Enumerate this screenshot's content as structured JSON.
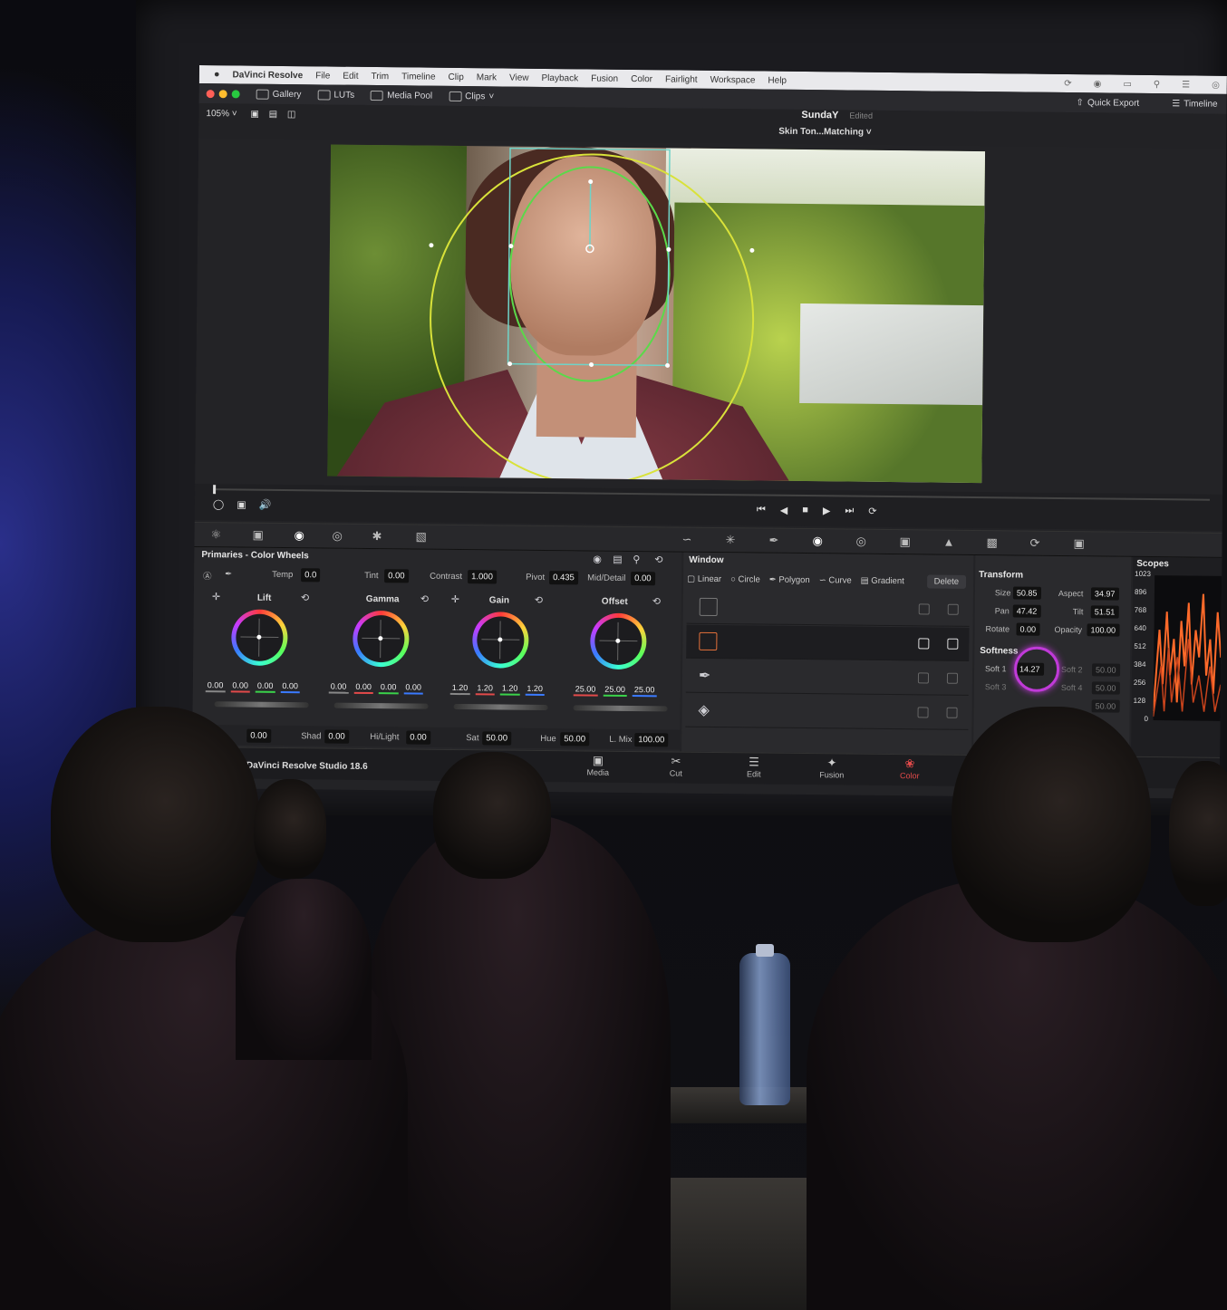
{
  "menubar": {
    "app_name": "DaVinci Resolve",
    "items": [
      "File",
      "Edit",
      "Trim",
      "Timeline",
      "Clip",
      "Mark",
      "View",
      "Playback",
      "Fusion",
      "Color",
      "Fairlight",
      "Workspace",
      "Help"
    ]
  },
  "toolbar": {
    "gallery": "Gallery",
    "luts": "LUTs",
    "media_pool": "Media Pool",
    "clips": "Clips",
    "quick_export": "Quick Export",
    "timeline": "Timeline"
  },
  "viewer_header": {
    "zoom": "105%",
    "project_name": "SundaY",
    "status": "Edited",
    "timeline_name": "Skin Ton...Matching"
  },
  "primaries": {
    "title": "Primaries - Color Wheels",
    "adjust": {
      "temp_label": "Temp",
      "temp": "0.0",
      "tint_label": "Tint",
      "tint": "0.00",
      "contrast_label": "Contrast",
      "contrast": "1.000",
      "pivot_label": "Pivot",
      "pivot": "0.435",
      "middetail_label": "Mid/Detail",
      "middetail": "0.00"
    },
    "wheels": [
      {
        "name": "Lift",
        "values": [
          "0.00",
          "0.00",
          "0.00",
          "0.00"
        ]
      },
      {
        "name": "Gamma",
        "values": [
          "0.00",
          "0.00",
          "0.00",
          "0.00"
        ]
      },
      {
        "name": "Gain",
        "values": [
          "1.20",
          "1.20",
          "1.20",
          "1.20"
        ]
      },
      {
        "name": "Offset",
        "values": [
          "25.00",
          "25.00",
          "25.00"
        ]
      }
    ],
    "bottom": {
      "first": "0.00",
      "shad_label": "Shad",
      "shad": "0.00",
      "hilight_label": "Hi/Light",
      "hilight": "0.00",
      "sat_label": "Sat",
      "sat": "50.00",
      "hue_label": "Hue",
      "hue": "50.00",
      "lmix_label": "L. Mix",
      "lmix": "100.00"
    }
  },
  "window_panel": {
    "title": "Window",
    "shapes": [
      "Linear",
      "Circle",
      "Polygon",
      "Curve",
      "Gradient"
    ],
    "delete": "Delete"
  },
  "transform": {
    "title": "Transform",
    "size_label": "Size",
    "size": "50.85",
    "aspect_label": "Aspect",
    "aspect": "34.97",
    "pan_label": "Pan",
    "pan": "47.42",
    "tilt_label": "Tilt",
    "tilt": "51.51",
    "rotate_label": "Rotate",
    "rotate": "0.00",
    "opacity_label": "Opacity",
    "opacity": "100.00",
    "softness_title": "Softness",
    "soft1_label": "Soft 1",
    "soft1": "14.27",
    "soft2_label": "Soft 2",
    "soft2": "50.00",
    "soft3_label": "Soft 3",
    "soft4_label": "Soft 4",
    "soft4": "50.00",
    "soft5": "50.00"
  },
  "scopes": {
    "title": "Scopes",
    "ticks": [
      "1023",
      "896",
      "768",
      "640",
      "512",
      "384",
      "256",
      "128",
      "0"
    ]
  },
  "pagebar": {
    "brand": "DaVinci Resolve Studio 18.6",
    "pages": [
      "Media",
      "Cut",
      "Edit",
      "Fusion",
      "Color"
    ],
    "active": "Color"
  },
  "colors": {
    "accent_active": "#e24a4a",
    "highlight_ring": "#c03ad8",
    "window_yellow": "#d9e23a",
    "window_green": "#5bd94a",
    "window_cyan": "#6fd3c8"
  }
}
